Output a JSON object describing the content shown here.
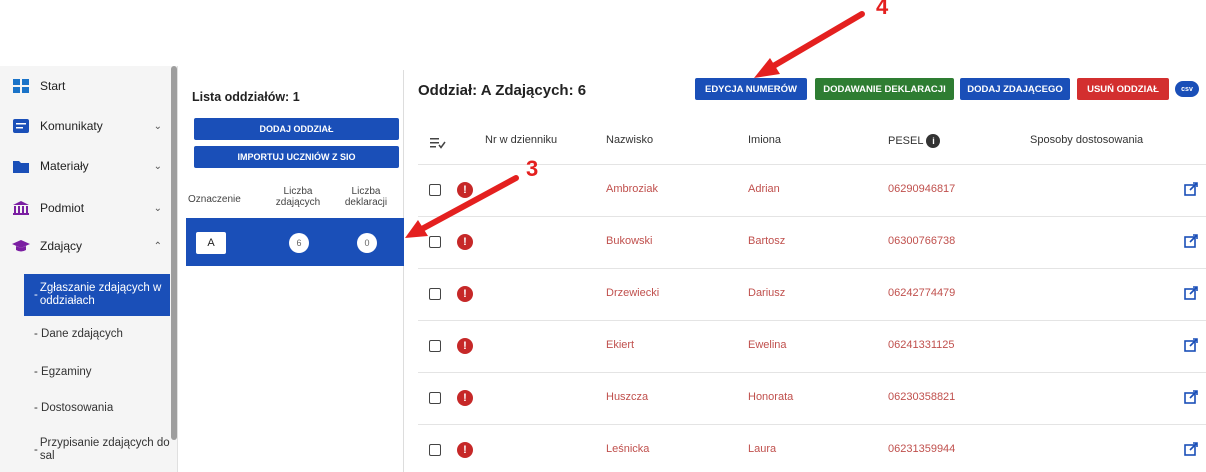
{
  "sidebar": {
    "items": [
      {
        "label": "Start",
        "icon": "grid-icon"
      },
      {
        "label": "Komunikaty",
        "icon": "message-icon"
      },
      {
        "label": "Materiały",
        "icon": "folder-icon"
      },
      {
        "label": "Podmiot",
        "icon": "building-icon"
      },
      {
        "label": "Zdający",
        "icon": "graduation-cap-icon"
      }
    ],
    "subitems": [
      {
        "label": "Zgłaszanie zdających w oddziałach",
        "prefix": "-"
      },
      {
        "label": "- Dane zdających"
      },
      {
        "label": "- Egzaminy"
      },
      {
        "label": "- Dostosowania"
      },
      {
        "label": "Przypisanie zdających do sal",
        "prefix": "-"
      }
    ]
  },
  "classes": {
    "title": "Lista oddziałów: 1",
    "add_button": "DODAJ ODDZIAŁ",
    "import_button": "IMPORTUJ UCZNIÓW Z SIO",
    "columns": {
      "mark": "Oznaczenie",
      "students_l1": "Liczba",
      "students_l2": "zdających",
      "decl_l1": "Liczba",
      "decl_l2": "deklaracji"
    },
    "row": {
      "mark": "A",
      "students": "6",
      "declarations": "0"
    }
  },
  "main": {
    "title": "Oddział: A Zdających: 6",
    "buttons": {
      "edit_numbers": "EDYCJA NUMERÓW",
      "add_declaration": "DODAWANIE DEKLARACJI",
      "add_student": "DODAJ ZDAJĄCEGO",
      "delete_class": "USUŃ ODDZIAŁ",
      "csv": "csv"
    },
    "columns": {
      "nr": "Nr w dzienniku",
      "surname": "Nazwisko",
      "names": "Imiona",
      "pesel": "PESEL",
      "adjust": "Sposoby dostosowania"
    },
    "rows": [
      {
        "surname": "Ambroziak",
        "name": "Adrian",
        "pesel": "06290946817"
      },
      {
        "surname": "Bukowski",
        "name": "Bartosz",
        "pesel": "06300766738"
      },
      {
        "surname": "Drzewiecki",
        "name": "Dariusz",
        "pesel": "06242774479"
      },
      {
        "surname": "Ekiert",
        "name": "Ewelina",
        "pesel": "06241331125"
      },
      {
        "surname": "Huszcza",
        "name": "Honorata",
        "pesel": "06230358821"
      },
      {
        "surname": "Leśnicka",
        "name": "Laura",
        "pesel": "06231359944"
      }
    ]
  },
  "annotations": {
    "label3": "3",
    "label4": "4"
  },
  "colors": {
    "primary": "#1a4fb8",
    "green": "#2e7d32",
    "red": "#d32f2f",
    "text_red": "#c0504d",
    "arrow": "#e4201f"
  }
}
